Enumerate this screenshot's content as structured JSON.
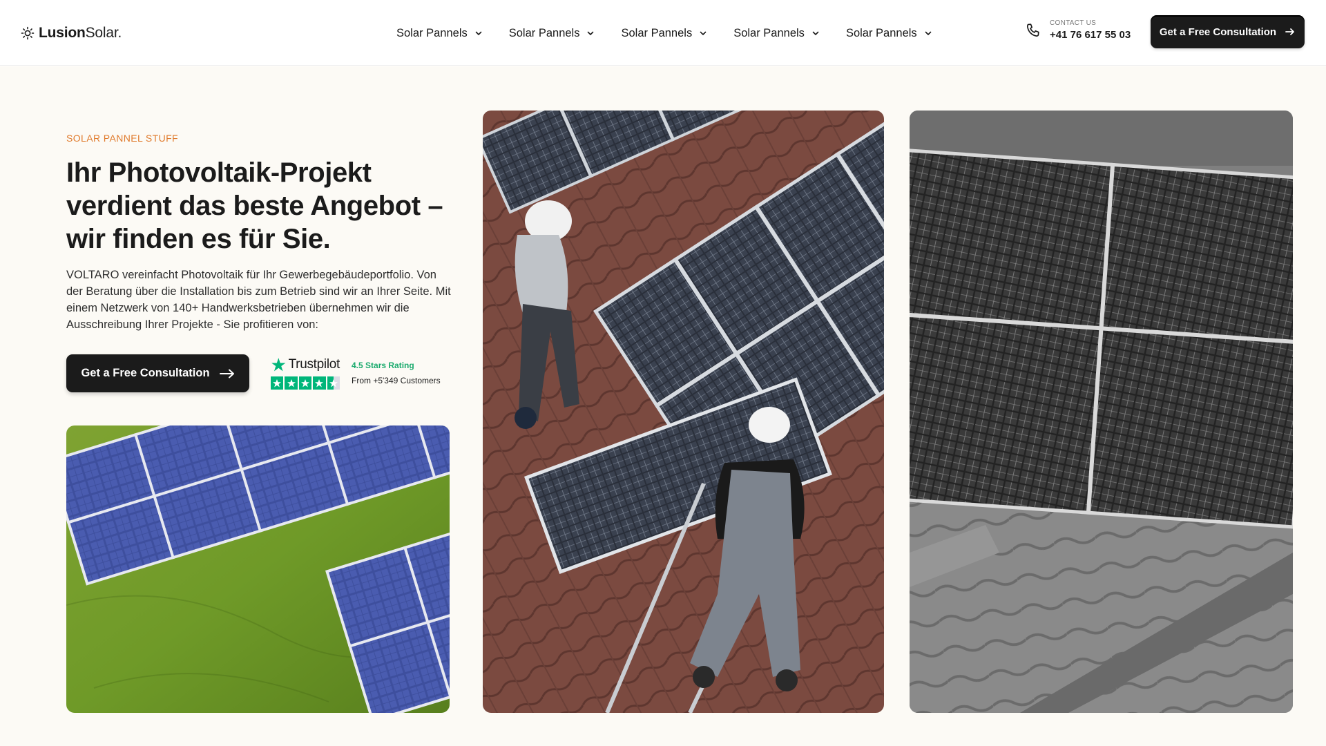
{
  "brand": {
    "name_bold": "Lusion",
    "name_light": "Solar."
  },
  "nav": {
    "items": [
      {
        "label": "Solar Pannels"
      },
      {
        "label": "Solar Pannels"
      },
      {
        "label": "Solar Pannels"
      },
      {
        "label": "Solar Pannels"
      },
      {
        "label": "Solar Pannels"
      }
    ]
  },
  "contact": {
    "label": "CONTACT US",
    "phone": "+41 76 617 55 03"
  },
  "header_cta": {
    "label": "Get a Free Consultation"
  },
  "hero": {
    "eyebrow": "SOLAR PANNEL STUFF",
    "headline": "Ihr Photovoltaik-Projekt verdient das beste Angebot – wir finden es für Sie.",
    "intro": "VOLTARO vereinfacht Photovoltaik für Ihr Gewerbegebäudeportfolio. Von der Beratung über die Installation bis zum Betrieb sind wir an Ihrer Seite. Mit einem Netzwerk von 140+ Handwerksbetrieben übernehmen wir die Ausschreibung Ihrer Projekte - Sie profitieren von:",
    "cta_label": "Get a Free Consultation"
  },
  "trustpilot": {
    "brand": "Trustpilot",
    "rating_value": 4.5,
    "rating_label": "4.5 Stars Rating",
    "customers": "From +5'349 Customers"
  },
  "colors": {
    "accent": "#e07b2d",
    "dark_button": "#1b1b1b",
    "trustpilot_green": "#00b67a",
    "hero_bg": "#fcfaf5"
  },
  "icons": {
    "logo": "sun-icon",
    "nav_chevron": "chevron-down-icon",
    "phone": "phone-icon",
    "arrow": "arrow-right-icon",
    "trust_star": "star-icon"
  }
}
